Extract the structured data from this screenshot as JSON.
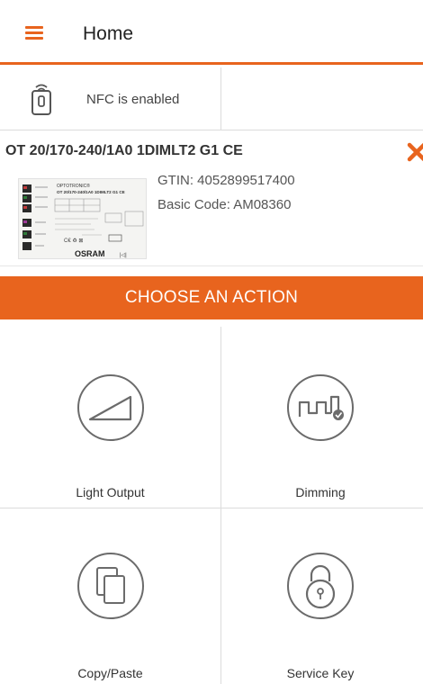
{
  "header": {
    "title": "Home"
  },
  "nfc": {
    "status_text": "NFC is enabled"
  },
  "product": {
    "name": "OT 20/170-240/1A0 1DIMLT2 G1 CE",
    "gtin": "GTIN: 4052899517400",
    "basic_code": "Basic Code: AM08360",
    "image_text": {
      "brand": "OSRAM",
      "line1": "OPTOTRONIC®",
      "line2": "OT 20/170-240/1A0 1DIMLT2 G1 CE"
    }
  },
  "action_bar": {
    "label": "CHOOSE AN ACTION"
  },
  "actions": [
    {
      "label": "Light Output",
      "icon": "light-output-icon"
    },
    {
      "label": "Dimming",
      "icon": "dimming-icon"
    },
    {
      "label": "Copy/Paste",
      "icon": "copy-paste-icon"
    },
    {
      "label": "Service Key",
      "icon": "service-key-icon"
    }
  ],
  "colors": {
    "accent": "#e8641e",
    "divider": "#dcdcdc",
    "icon_gray": "#6b6b6b"
  }
}
